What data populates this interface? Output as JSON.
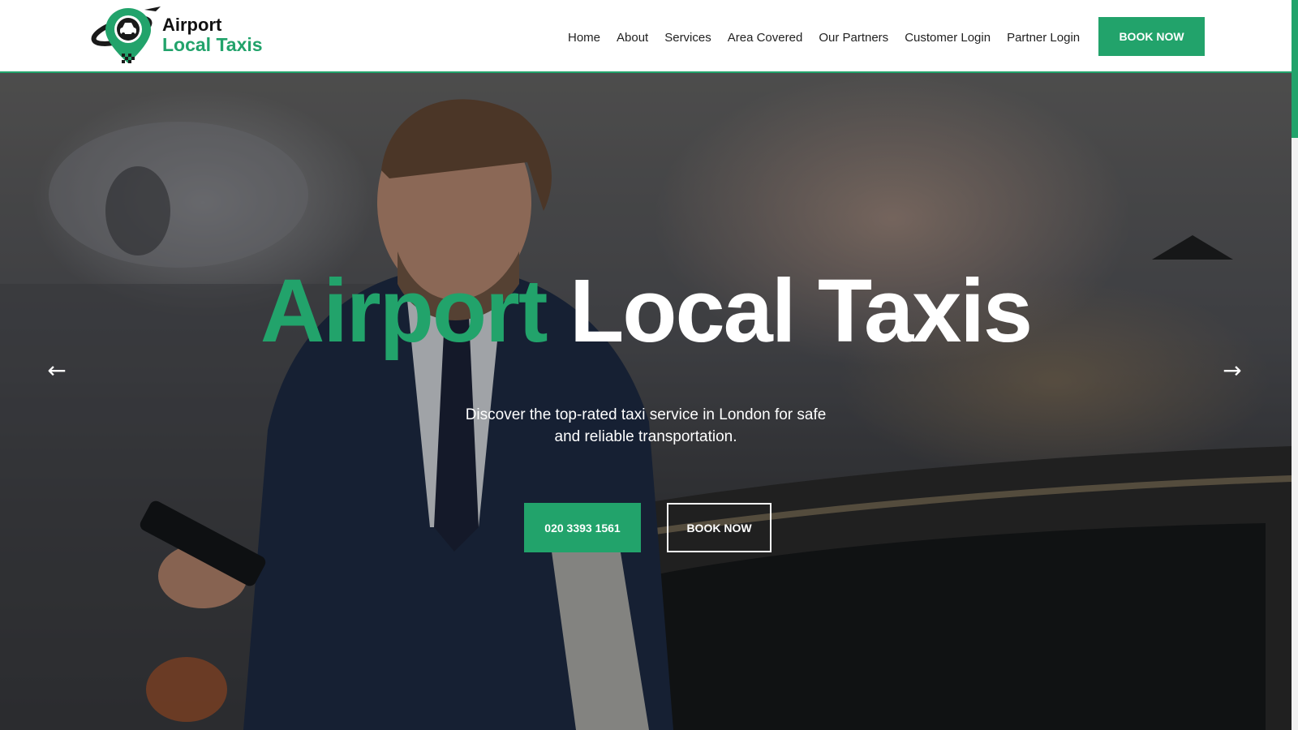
{
  "brand": {
    "line1": "Airport",
    "line2": "Local Taxis",
    "accent_color": "#22a36b",
    "logo_icon": "map-pin-taxi-icon"
  },
  "nav": {
    "items": [
      {
        "label": "Home"
      },
      {
        "label": "About"
      },
      {
        "label": "Services"
      },
      {
        "label": "Area Covered"
      },
      {
        "label": "Our Partners"
      },
      {
        "label": "Customer Login"
      },
      {
        "label": "Partner Login"
      }
    ],
    "cta_label": "BOOK NOW"
  },
  "hero": {
    "title_accent": "Airport",
    "title_rest": "Local Taxis",
    "subtitle": "Discover the top-rated taxi service in London for safe and reliable transportation.",
    "phone_button": "020 3393 1561",
    "book_button": "BOOK NOW",
    "prev_arrow": "←",
    "next_arrow": "→",
    "background_image": "businessman-with-phone-at-taxi-photo"
  }
}
